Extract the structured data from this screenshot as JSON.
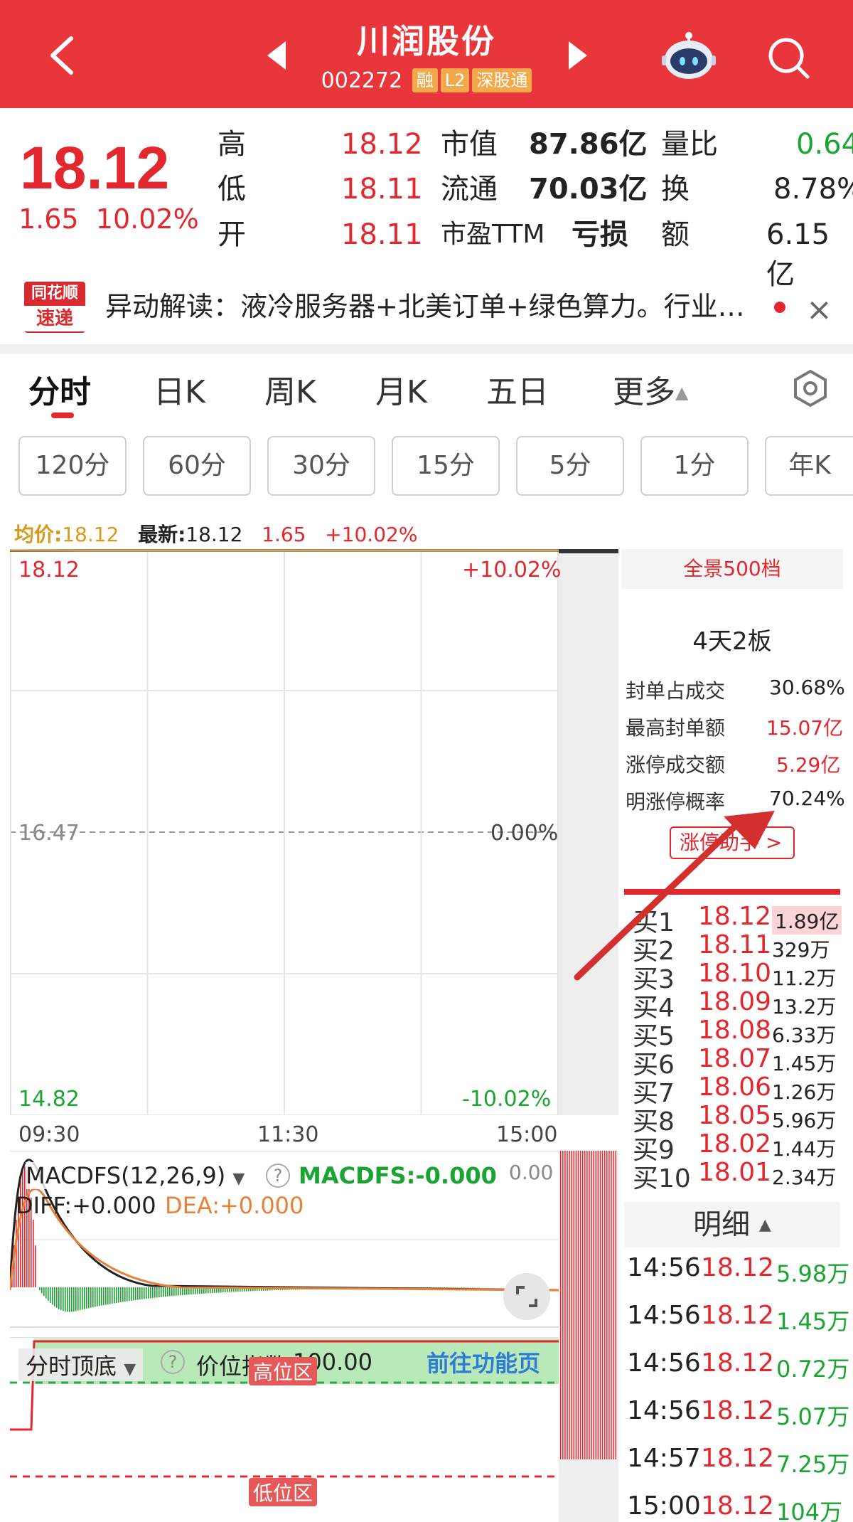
{
  "header": {
    "stock_name": "川润股份",
    "stock_code": "002272",
    "tags": [
      "融",
      "L2",
      "深股通"
    ]
  },
  "quote": {
    "price": "18.12",
    "change": "1.65",
    "change_pct": "10.02%",
    "fields": [
      {
        "label": "高",
        "value": "18.12"
      },
      {
        "label": "低",
        "value": "18.11"
      },
      {
        "label": "开",
        "value": "18.11"
      },
      {
        "label": "市值",
        "value": "87.86亿"
      },
      {
        "label": "流通",
        "value": "70.03亿"
      },
      {
        "label": "市盈TTM",
        "value": "亏损"
      },
      {
        "label": "量比",
        "value": "0.64"
      },
      {
        "label": "换",
        "value": "8.78%"
      },
      {
        "label": "额",
        "value": "6.15亿"
      }
    ]
  },
  "news": {
    "logo_top": "同花顺",
    "logo_bottom": "速递",
    "text": "异动解读：液冷服务器+北美订单+绿色算力。行业…"
  },
  "tabs": [
    "分时",
    "日K",
    "周K",
    "月K",
    "五日",
    "更多"
  ],
  "periods": [
    "120分",
    "60分",
    "30分",
    "15分",
    "5分",
    "1分",
    "年K"
  ],
  "chart_info": {
    "avg_label": "均价:",
    "avg_value": "18.12",
    "latest_label": "最新:",
    "latest_value": "18.12",
    "change": "1.65",
    "change_pct": "+10.02%"
  },
  "chart_data": {
    "type": "line",
    "y_labels_left": [
      "18.12",
      "16.47",
      "14.82"
    ],
    "y_labels_right": [
      "+10.02%",
      "0.00%",
      "-10.02%"
    ],
    "x_labels": [
      "09:30",
      "11:30",
      "15:00"
    ],
    "ylim": [
      14.82,
      18.12
    ],
    "prev_close": 16.47,
    "series": [
      {
        "values": [
          18.11,
          18.12,
          18.12,
          18.12,
          18.12,
          18.12,
          18.12
        ]
      }
    ]
  },
  "macd": {
    "name": "MACDFS(12,26,9)",
    "value_label": "MACDFS:",
    "value": "-0.000",
    "diff_label": "DIFF:",
    "diff": "+0.000",
    "dea_label": "DEA:",
    "dea": "+0.000",
    "right_value": "0.00"
  },
  "indicator2": {
    "name": "分时顶底",
    "index_label": "价位指数",
    "index_value": "100.00",
    "link": "前往功能页",
    "high_zone": "高位区",
    "low_zone": "低位区"
  },
  "panel": {
    "title": "全景500档",
    "board": "4天2板",
    "stats": [
      {
        "label": "封单占成交",
        "value": "30.68%",
        "color": "dark"
      },
      {
        "label": "最高封单额",
        "value": "15.07亿",
        "color": "red"
      },
      {
        "label": "涨停成交额",
        "value": "5.29亿",
        "color": "red"
      },
      {
        "label": "明涨停概率",
        "value": "70.24%",
        "color": "dark"
      }
    ],
    "button": "涨停助手"
  },
  "order_book": [
    {
      "level": "买1",
      "price": "18.12",
      "volume": "1.89亿"
    },
    {
      "level": "买2",
      "price": "18.11",
      "volume": "329万"
    },
    {
      "level": "买3",
      "price": "18.10",
      "volume": "11.2万"
    },
    {
      "level": "买4",
      "price": "18.09",
      "volume": "13.2万"
    },
    {
      "level": "买5",
      "price": "18.08",
      "volume": "6.33万"
    },
    {
      "level": "买6",
      "price": "18.07",
      "volume": "1.45万"
    },
    {
      "level": "买7",
      "price": "18.06",
      "volume": "1.26万"
    },
    {
      "level": "买8",
      "price": "18.05",
      "volume": "5.96万"
    },
    {
      "level": "买9",
      "price": "18.02",
      "volume": "1.44万"
    },
    {
      "level": "买10",
      "price": "18.01",
      "volume": "2.34万"
    }
  ],
  "detail": {
    "title": "明细",
    "trades": [
      {
        "time": "14:56",
        "price": "18.12",
        "volume": "5.98万"
      },
      {
        "time": "14:56",
        "price": "18.12",
        "volume": "1.45万"
      },
      {
        "time": "14:56",
        "price": "18.12",
        "volume": "0.72万"
      },
      {
        "time": "14:56",
        "price": "18.12",
        "volume": "5.07万"
      },
      {
        "time": "14:57",
        "price": "18.12",
        "volume": "7.25万"
      },
      {
        "time": "15:00",
        "price": "18.12",
        "volume": "104万"
      }
    ]
  },
  "colors": {
    "up": "#e3272e",
    "down": "#1aa532",
    "header": "#e9363b"
  }
}
